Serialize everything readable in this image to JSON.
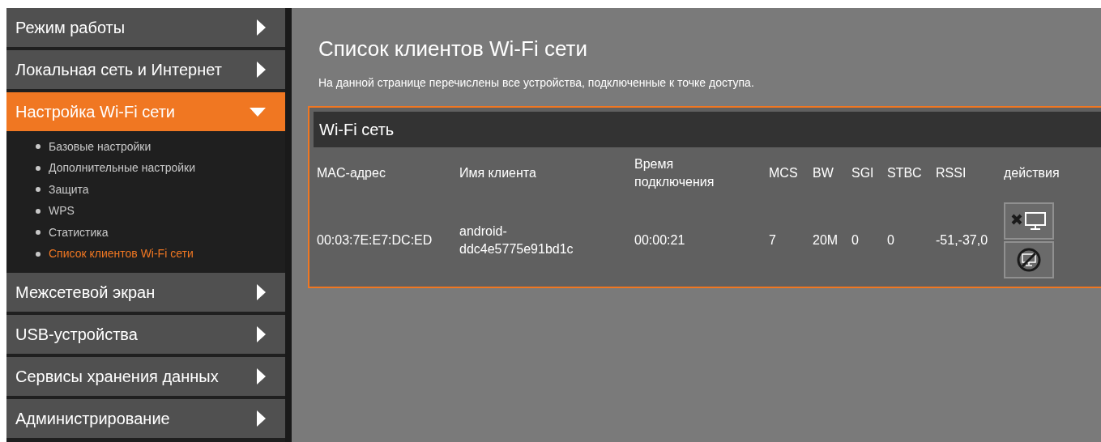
{
  "sidebar": {
    "items": [
      {
        "label": "Режим работы",
        "expanded": false
      },
      {
        "label": "Локальная сеть и Интернет",
        "expanded": false
      },
      {
        "label": "Настройка Wi-Fi сети",
        "expanded": true,
        "children": [
          {
            "label": "Базовые настройки",
            "selected": false
          },
          {
            "label": "Дополнительные настройки",
            "selected": false
          },
          {
            "label": "Защита",
            "selected": false
          },
          {
            "label": "WPS",
            "selected": false
          },
          {
            "label": "Статистика",
            "selected": false
          },
          {
            "label": "Список клиентов Wi-Fi сети",
            "selected": true
          }
        ]
      },
      {
        "label": "Межсетевой экран",
        "expanded": false
      },
      {
        "label": "USB-устройства",
        "expanded": false
      },
      {
        "label": "Сервисы хранения данных",
        "expanded": false
      },
      {
        "label": "Администрирование",
        "expanded": false
      }
    ]
  },
  "page": {
    "title": "Список клиентов Wi-Fi сети",
    "description": "На данной странице перечислены все устройства, подключенные к точке доступа."
  },
  "panel": {
    "title": "Wi-Fi сеть",
    "table": {
      "columns": [
        "MAC-адрес",
        "Имя клиента",
        "Время подключения",
        "MCS",
        "BW",
        "SGI",
        "STBC",
        "RSSI",
        "действия"
      ],
      "rows": [
        {
          "cells": [
            "00:03:7E:E7:DC:ED",
            "android-ddc4e5775e91bd1c",
            "00:00:21",
            "7",
            "20M",
            "0",
            "0",
            "-51,-37,0"
          ]
        }
      ]
    }
  }
}
